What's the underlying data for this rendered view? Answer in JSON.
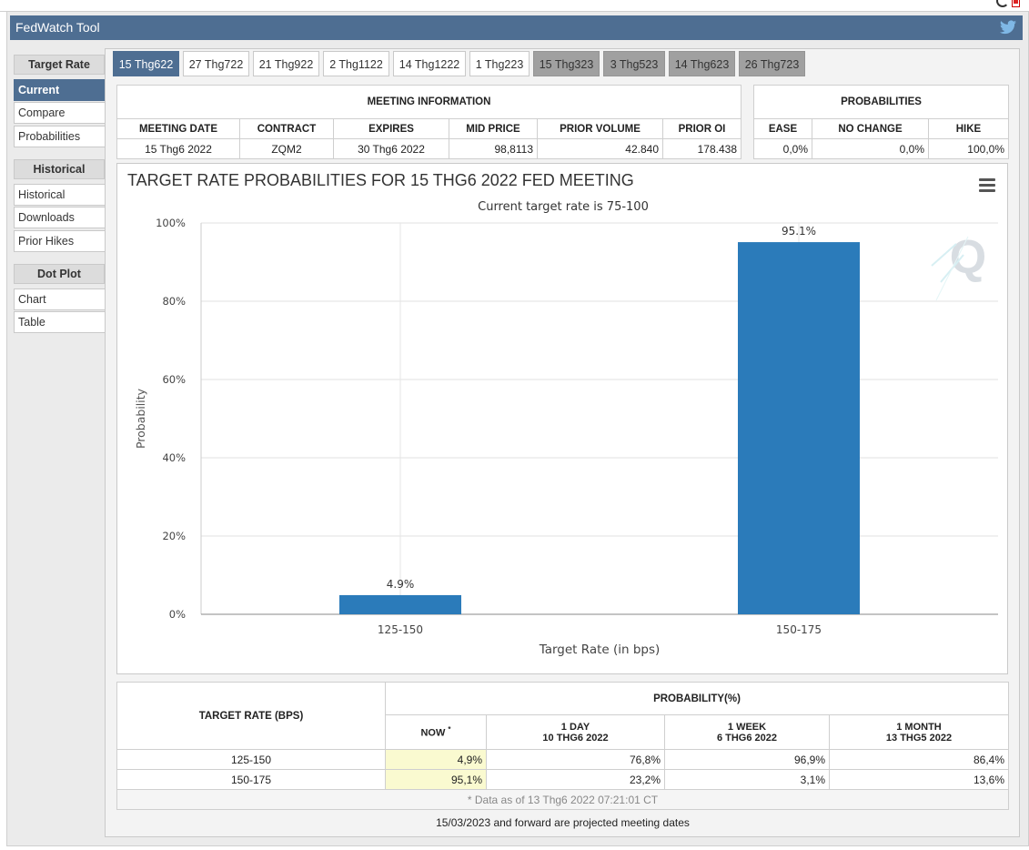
{
  "app": {
    "title": "FedWatch Tool"
  },
  "icons": {
    "twitter": "twitter-icon",
    "menu": "hamburger-menu-icon",
    "refresh": "refresh-icon",
    "document": "document-icon"
  },
  "sidebar": {
    "sections": [
      {
        "heading": "Target Rate",
        "items": [
          {
            "label": "Current",
            "active": true
          },
          {
            "label": "Compare"
          },
          {
            "label": "Probabilities"
          }
        ]
      },
      {
        "heading": "Historical",
        "items": [
          {
            "label": "Historical"
          },
          {
            "label": "Downloads"
          },
          {
            "label": "Prior Hikes"
          }
        ]
      },
      {
        "heading": "Dot Plot",
        "items": [
          {
            "label": "Chart"
          },
          {
            "label": "Table"
          }
        ]
      }
    ]
  },
  "tabs": [
    {
      "label": "15 Thg622",
      "state": "active"
    },
    {
      "label": "27 Thg722",
      "state": "normal"
    },
    {
      "label": "21 Thg922",
      "state": "normal"
    },
    {
      "label": "2 Thg1122",
      "state": "normal"
    },
    {
      "label": "14 Thg1222",
      "state": "normal"
    },
    {
      "label": "1 Thg223",
      "state": "normal"
    },
    {
      "label": "15 Thg323",
      "state": "projected"
    },
    {
      "label": "3 Thg523",
      "state": "projected"
    },
    {
      "label": "14 Thg623",
      "state": "projected"
    },
    {
      "label": "26 Thg723",
      "state": "projected"
    }
  ],
  "meeting_info": {
    "heading": "MEETING INFORMATION",
    "columns": [
      "MEETING DATE",
      "CONTRACT",
      "EXPIRES",
      "MID PRICE",
      "PRIOR VOLUME",
      "PRIOR OI"
    ],
    "row": [
      "15 Thg6 2022",
      "ZQM2",
      "30 Thg6 2022",
      "98,8113",
      "42.840",
      "178.438"
    ]
  },
  "probabilities": {
    "heading": "PROBABILITIES",
    "columns": [
      "EASE",
      "NO CHANGE",
      "HIKE"
    ],
    "row": [
      "0,0%",
      "0,0%",
      "100,0%"
    ]
  },
  "chart": {
    "title": "TARGET RATE PROBABILITIES FOR 15 THG6 2022 FED MEETING",
    "subtitle": "Current target rate is 75-100",
    "watermark": "Q"
  },
  "chart_data": {
    "type": "bar",
    "title": "TARGET RATE PROBABILITIES FOR 15 THG6 2022 FED MEETING",
    "subtitle": "Current target rate is 75-100",
    "categories": [
      "125-150",
      "150-175"
    ],
    "values": [
      4.9,
      95.1
    ],
    "data_labels": [
      "4.9%",
      "95.1%"
    ],
    "xlabel": "Target Rate (in bps)",
    "ylabel": "Probability",
    "ylim": [
      0,
      100
    ],
    "yticks": [
      "0%",
      "20%",
      "40%",
      "60%",
      "80%",
      "100%"
    ],
    "grid": true,
    "bar_color": "#2b7bba"
  },
  "history": {
    "col_target": "TARGET RATE (BPS)",
    "col_prob": "PROBABILITY(%)",
    "sub_now": "NOW",
    "now_mark": "*",
    "sub_1day": [
      "1 DAY",
      "10 THG6 2022"
    ],
    "sub_1week": [
      "1 WEEK",
      "6 THG6 2022"
    ],
    "sub_1month": [
      "1 MONTH",
      "13 THG5 2022"
    ],
    "rows": [
      [
        "125-150",
        "4,9%",
        "76,8%",
        "96,9%",
        "86,4%"
      ],
      [
        "150-175",
        "95,1%",
        "23,2%",
        "3,1%",
        "13,6%"
      ]
    ],
    "footnote": "* Data as of 13 Thg6 2022 07:21:01 CT"
  },
  "projected_note": "15/03/2023 and forward are projected meeting dates",
  "colors": {
    "header": "#4e6e92",
    "bar": "#2b7bba",
    "highlight": "#fafad0",
    "projected_tab": "#a0a0a0"
  }
}
